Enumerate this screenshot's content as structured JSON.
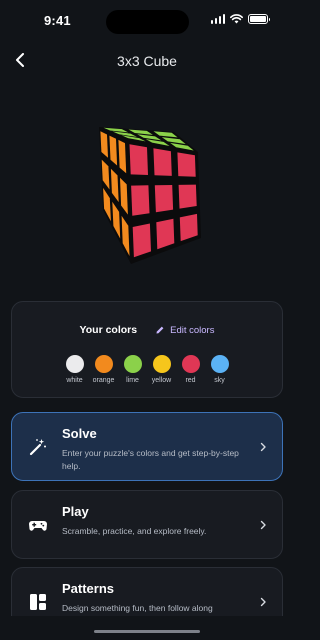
{
  "status_bar": {
    "time": "9:41"
  },
  "nav": {
    "title": "3x3 Cube",
    "back_icon": "chevron-left-icon"
  },
  "cube": {
    "top_color": "#8bd14a",
    "left_color": "#f28a1e",
    "front_color": "#e03755",
    "edge_color": "#0b0b0c"
  },
  "colors_card": {
    "title": "Your colors",
    "edit_label": "Edit colors",
    "edit_icon": "pencil-icon",
    "accent": "#c9b8ff",
    "swatches": [
      {
        "label": "white",
        "color": "#ebebed"
      },
      {
        "label": "orange",
        "color": "#f28a1e"
      },
      {
        "label": "lime",
        "color": "#8bd14a"
      },
      {
        "label": "yellow",
        "color": "#f6c61c"
      },
      {
        "label": "red",
        "color": "#e03755"
      },
      {
        "label": "sky",
        "color": "#5bb2f5"
      }
    ]
  },
  "actions": [
    {
      "title": "Solve",
      "description": "Enter your puzzle's colors and get step-by-step help.",
      "icon": "magic-wand-icon",
      "active": true
    },
    {
      "title": "Play",
      "description": "Scramble, practice, and explore freely.",
      "icon": "gamepad-icon",
      "active": false
    },
    {
      "title": "Patterns",
      "description": "Design something fun, then follow along",
      "icon": "grid-layout-icon",
      "active": false
    }
  ]
}
